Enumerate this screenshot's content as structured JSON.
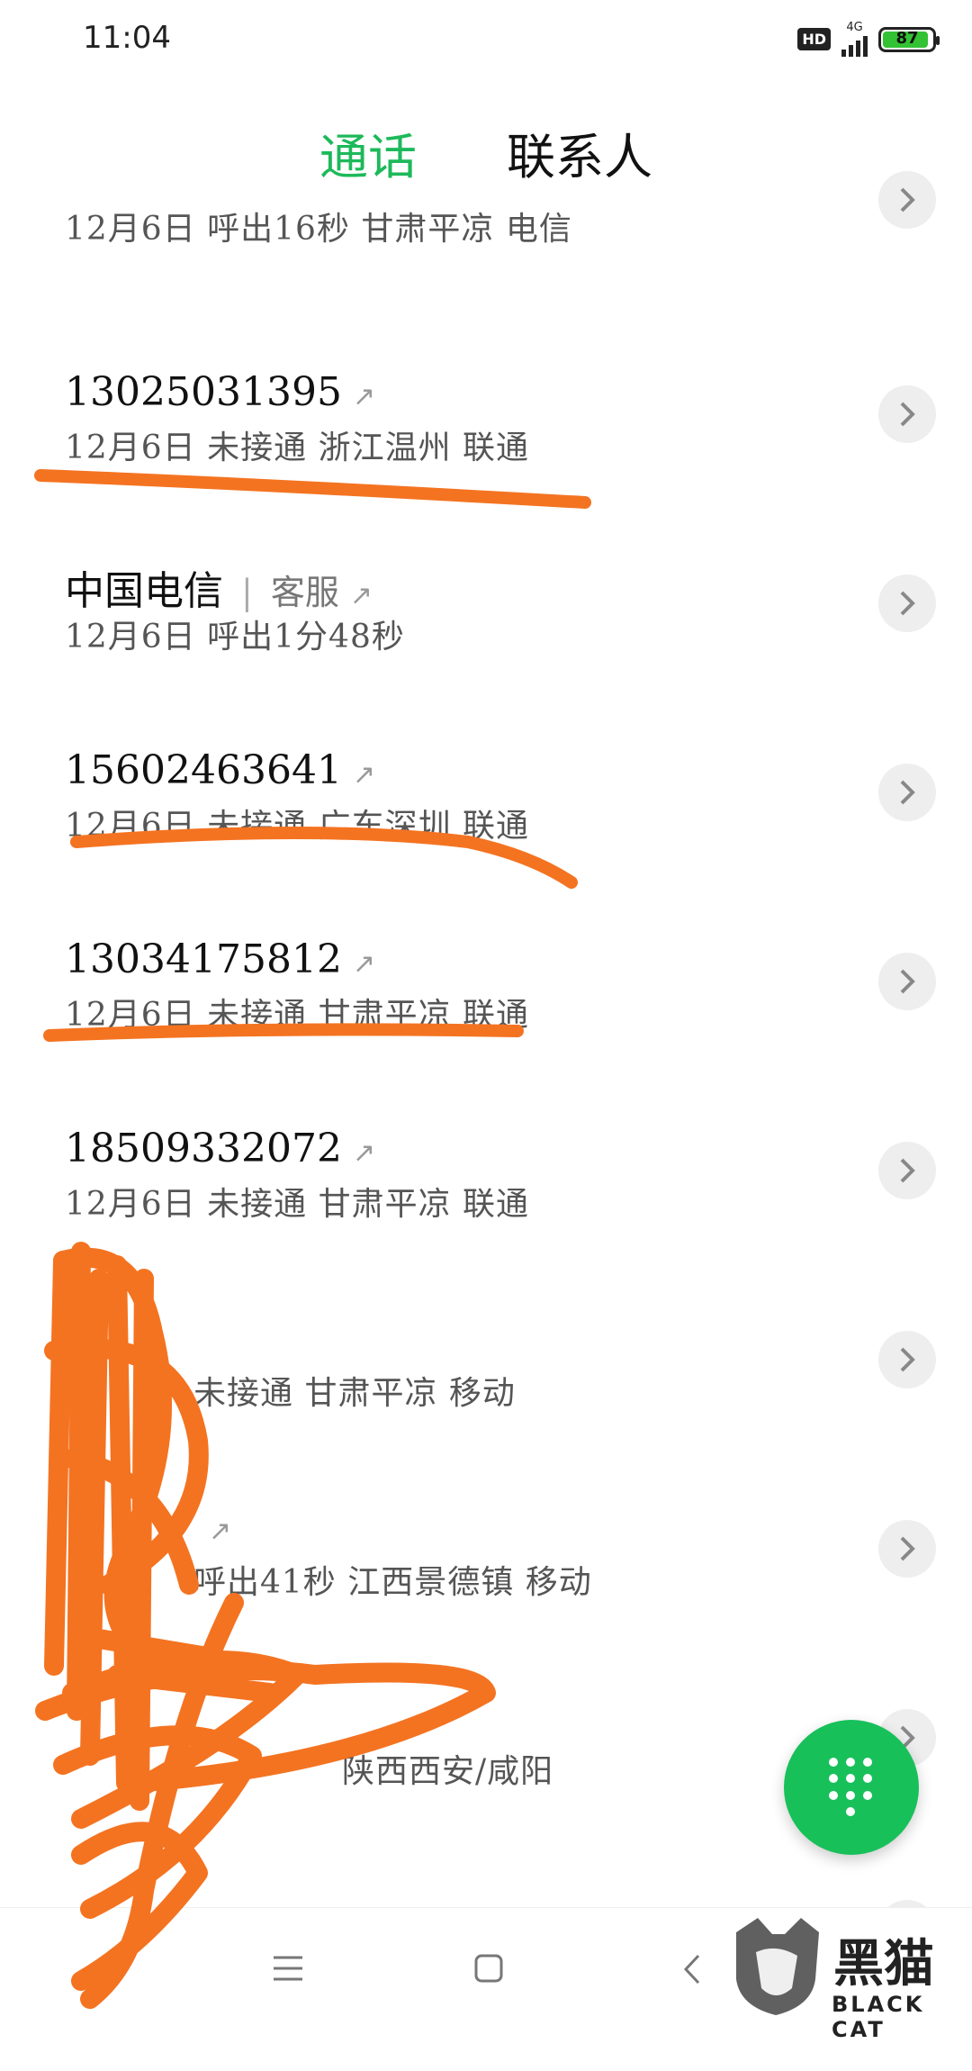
{
  "status": {
    "time": "11:04",
    "hd": "HD",
    "network": "4G",
    "battery": "87"
  },
  "tabs": [
    {
      "label": "通话"
    },
    {
      "label": "联系人"
    }
  ],
  "calls": [
    {
      "name": "",
      "sub": "",
      "detail": "12月6日 呼出16秒 甘肃平凉 电信"
    },
    {
      "name": "13025031395",
      "sub": "",
      "detail": "12月6日 未接通 浙江温州 联通"
    },
    {
      "name": "中国电信",
      "sub": "客服",
      "detail": "12月6日 呼出1分48秒"
    },
    {
      "name": "15602463641",
      "sub": "",
      "detail": "12月6日 未接通 广东深圳 联通"
    },
    {
      "name": "13034175812",
      "sub": "",
      "detail": "12月6日 未接通 甘肃平凉 联通"
    },
    {
      "name": "18509332072",
      "sub": "",
      "detail": "12月6日 未接通 甘肃平凉 联通"
    },
    {
      "name": "",
      "sub": "",
      "detail": "未接通 甘肃平凉 移动"
    },
    {
      "name": "",
      "sub": "",
      "detail": "呼出41秒 江西景德镇 移动"
    },
    {
      "name": "",
      "sub": "",
      "detail": "陕西西安/咸阳"
    },
    {
      "name": "",
      "sub": "",
      "detail": ""
    }
  ],
  "watermark": {
    "title": "黑猫",
    "subtitle": "BLACK CAT"
  },
  "colors": {
    "accent": "#1db95a",
    "fab": "#18c05a",
    "annotation": "#f47321"
  }
}
